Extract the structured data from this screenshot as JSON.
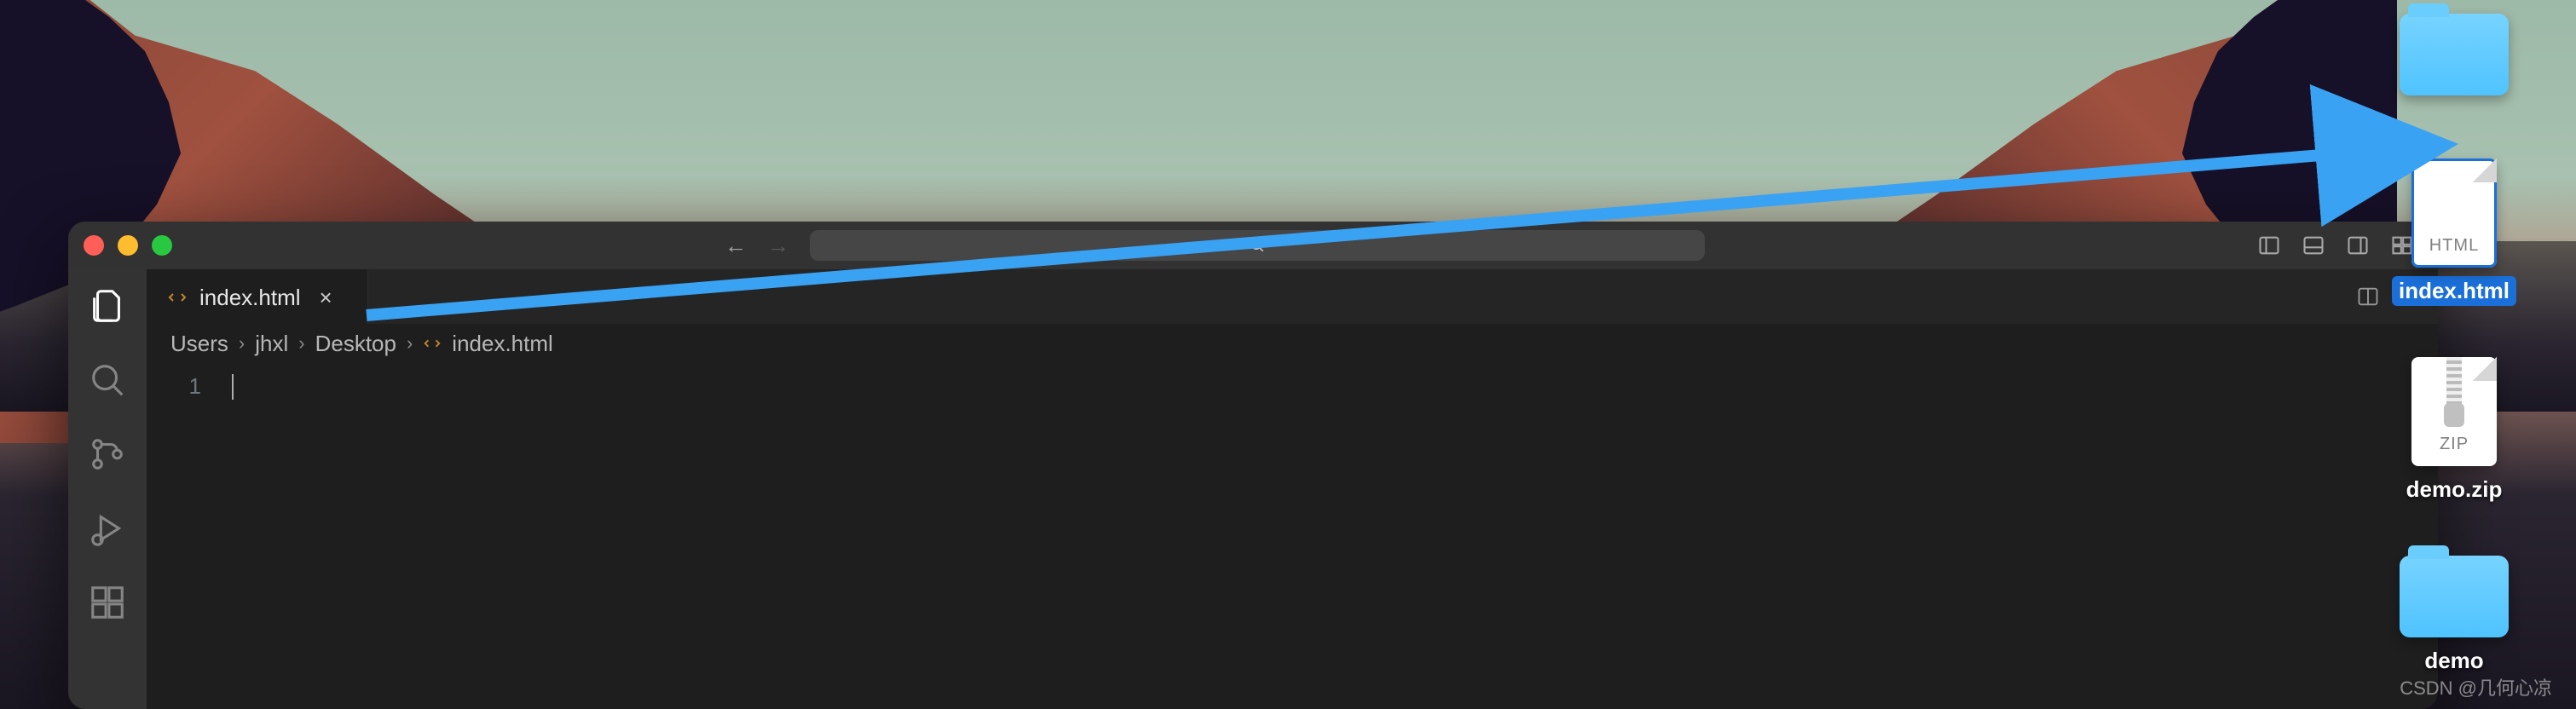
{
  "desktop": {
    "items": [
      {
        "type": "folder",
        "label": ""
      },
      {
        "type": "html-file",
        "label": "index.html",
        "tag": "HTML",
        "selected": true
      },
      {
        "type": "zip-file",
        "label": "demo.zip",
        "tag": "ZIP"
      },
      {
        "type": "folder",
        "label": "demo"
      }
    ]
  },
  "vscode": {
    "tabs": [
      {
        "filename": "index.html"
      }
    ],
    "breadcrumb": {
      "segments": [
        "Users",
        "jhxl",
        "Desktop"
      ],
      "file": "index.html"
    },
    "editor": {
      "line_numbers": [
        "1"
      ],
      "content": ""
    }
  },
  "watermark": "CSDN @几何心凉"
}
